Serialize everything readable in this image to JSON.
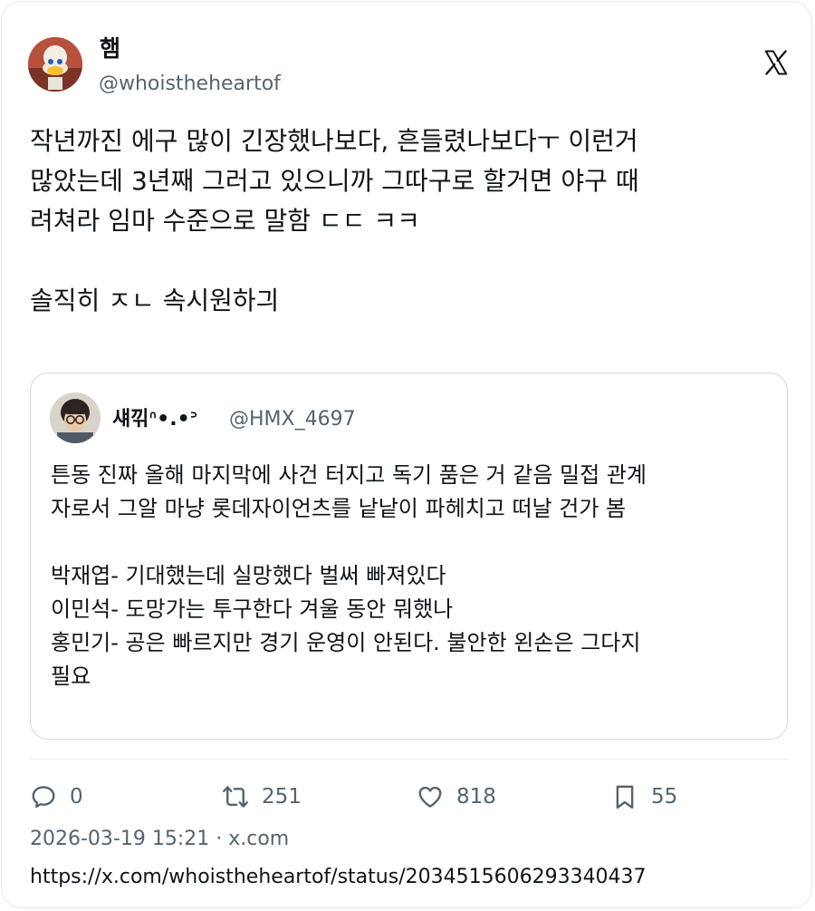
{
  "author": {
    "name": "햄",
    "handle": "@whoistheheartof"
  },
  "tweet": {
    "lines": [
      "작년까진 에구 많이 긴장했나보다, 흔들렸나보다ㅜ 이런거",
      "많았는데 3년째 그러고 있으니까 그따구로 할거면 야구 때",
      "려쳐라 임마 수준으로 말함 ㄷㄷ ㅋㅋ",
      "솔직히 ㅈㄴ 속시원하긔"
    ]
  },
  "quoted_tweet": {
    "name": "섀끾ᐢ•.•ᐣ",
    "handle": "@HMX_4697",
    "lines": [
      "튼동 진짜 올해 마지막에 사건 터지고 독기 품은 거 같음 밀접 관계",
      "자로서 그알 마냥 롯데자이언츠를 낱낱이 파헤치고 떠날 건가 봄",
      "박재엽- 기대했는데 실망했다 벌써 빠져있다",
      "이민석- 도망가는 투구한다 겨울 동안 뭐했나",
      "홍민기- 공은 빠르지만 경기 운영이 안된다. 불안한 왼손은 그다지",
      "필요"
    ]
  },
  "actions": {
    "replies": "0",
    "retweets": "251",
    "likes": "818",
    "bookmarks": "55"
  },
  "meta": {
    "timestamp": "2026-03-19 15:21 · x.com",
    "url": "https://x.com/whoistheheartof/status/2034515606293340437"
  },
  "icons": {
    "x_logo": "x-logo-icon",
    "reply": "reply-icon",
    "retweet": "retweet-icon",
    "like": "heart-icon",
    "bookmark": "bookmark-icon"
  }
}
